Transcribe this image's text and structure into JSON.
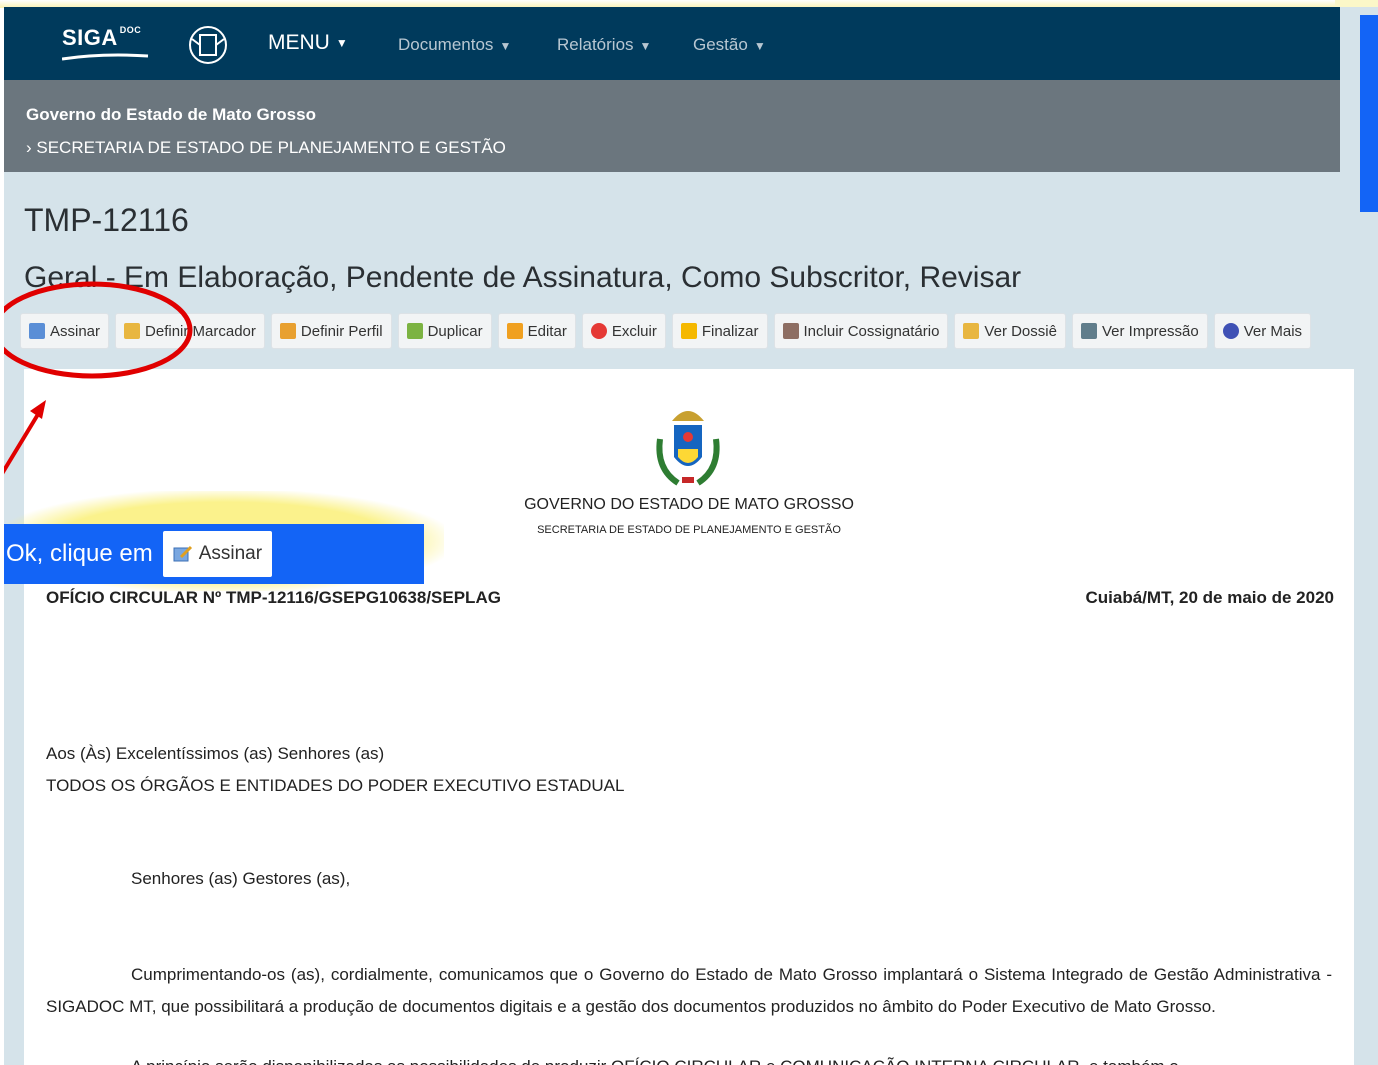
{
  "navbar": {
    "logo_text": "SIGA",
    "logo_sup": "DOC",
    "menu_label": "MENU",
    "items": [
      "Documentos",
      "Relatórios",
      "Gestão"
    ]
  },
  "org": {
    "line1": "Governo do Estado de Mato Grosso",
    "line2": "› SECRETARIA DE ESTADO DE PLANEJAMENTO E GESTÃO"
  },
  "document_header": {
    "code": "TMP-12116",
    "status": "Geral - Em Elaboração, Pendente de Assinatura, Como Subscritor, Revisar"
  },
  "toolbar": [
    {
      "label": "Assinar",
      "icon": "sign-icon",
      "color": "#5a8ed6"
    },
    {
      "label": "Definir Marcador",
      "icon": "bookmark-icon",
      "color": "#e8b640"
    },
    {
      "label": "Definir Perfil",
      "icon": "profile-icon",
      "color": "#e8a030"
    },
    {
      "label": "Duplicar",
      "icon": "duplicate-icon",
      "color": "#7cb342"
    },
    {
      "label": "Editar",
      "icon": "pencil-icon",
      "color": "#f0a020"
    },
    {
      "label": "Excluir",
      "icon": "delete-icon",
      "color": "#e53935"
    },
    {
      "label": "Finalizar",
      "icon": "lock-icon",
      "color": "#f5b800"
    },
    {
      "label": "Incluir Cossignatário",
      "icon": "users-icon",
      "color": "#8d6e63"
    },
    {
      "label": "Ver Dossiê",
      "icon": "folder-icon",
      "color": "#e8b640"
    },
    {
      "label": "Ver Impressão",
      "icon": "printer-icon",
      "color": "#607d8b"
    },
    {
      "label": "Ver Mais",
      "icon": "eye-icon",
      "color": "#3f51b5"
    }
  ],
  "document": {
    "gov_title": "GOVERNO DO ESTADO DE MATO GROSSO",
    "sec_title": "SECRETARIA DE ESTADO DE PLANEJAMENTO E GESTÃO",
    "oficio": "OFÍCIO CIRCULAR Nº TMP-12116/GSEPG10638/SEPLAG",
    "date_place": "Cuiabá/MT, 20 de maio de 2020",
    "recipient_line1": "Aos (Às) Excelentíssimos (as) Senhores (as)",
    "recipient_line2": "TODOS OS ÓRGÃOS E ENTIDADES DO PODER EXECUTIVO ESTADUAL",
    "salutation": "Senhores (as) Gestores (as),",
    "paragraph1": "Cumprimentando-os (as), cordialmente, comunicamos que o Governo do Estado de Mato Grosso implantará o Sistema Integrado de Gestão Administrativa - SIGADOC MT, que possibilitará a produção de documentos digitais e a gestão dos documentos produzidos no âmbito do Poder Executivo de Mato Grosso.",
    "paragraph2": "A princípio serão disponibilizadas as possibilidades de produzir OFÍCIO CIRCULAR e COMUNICAÇÃO INTERNA CIRCULAR, e também o"
  },
  "annotation": {
    "callout_text": "Ok, clique em",
    "callout_button": "Assinar",
    "colors": {
      "callout": "#1364f6",
      "highlight": "#e00000"
    }
  }
}
